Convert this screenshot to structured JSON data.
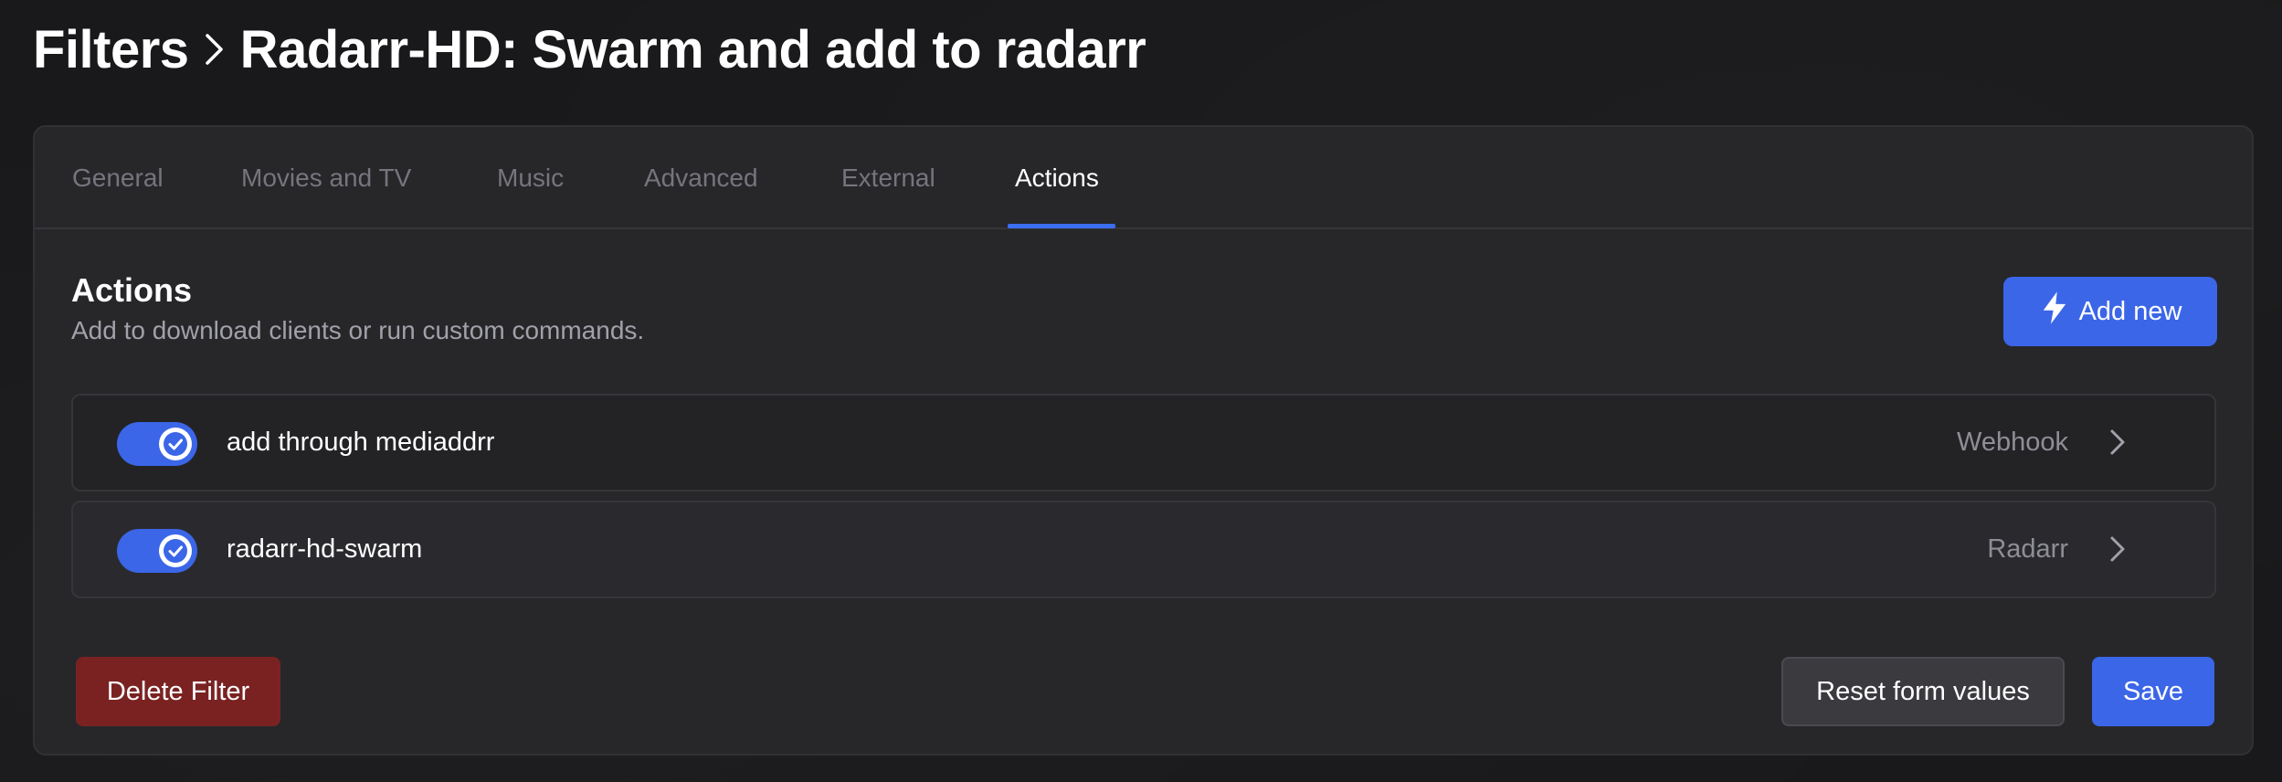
{
  "header": {
    "breadcrumb_root": "Filters",
    "breadcrumb_current": "Radarr-HD: Swarm and add to radarr"
  },
  "tabs": [
    {
      "label": "General",
      "active": false
    },
    {
      "label": "Movies and TV",
      "active": false
    },
    {
      "label": "Music",
      "active": false
    },
    {
      "label": "Advanced",
      "active": false
    },
    {
      "label": "External",
      "active": false
    },
    {
      "label": "Actions",
      "active": true
    }
  ],
  "section": {
    "title": "Actions",
    "subtitle": "Add to download clients or run custom commands.",
    "add_button": "Add new",
    "add_icon": "bolt-icon"
  },
  "actions": [
    {
      "name": "add through mediaddrr",
      "type": "Webhook",
      "enabled": true
    },
    {
      "name": "radarr-hd-swarm",
      "type": "Radarr",
      "enabled": true
    }
  ],
  "footer": {
    "delete_label": "Delete Filter",
    "reset_label": "Reset form values",
    "save_label": "Save"
  },
  "colors": {
    "accent": "#3b66e8",
    "danger": "#7a2222",
    "card_bg": "#27272a",
    "page_bg": "#19191b"
  }
}
